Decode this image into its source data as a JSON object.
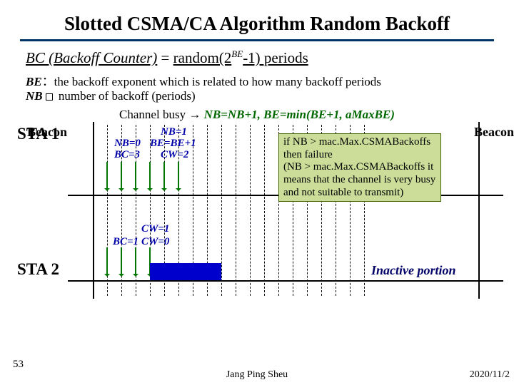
{
  "title": "Slotted CSMA/CA Algorithm Random Backoff",
  "formula": {
    "lhs": "BC (Backoff Counter)",
    "eq": " = ",
    "rhs_a": "random(2",
    "rhs_sup": "BE",
    "rhs_b": "-1) periods"
  },
  "defs": {
    "be_var": "BE",
    "be_text": "：the backoff exponent which is related to how many backoff periods",
    "nb_var": "NB",
    "nb_text": " number of backoff (periods)"
  },
  "rule": {
    "pre": "Channel busy",
    "arrow": " → ",
    "upd": "NB=NB+1,  BE=min(BE+1, aMaxBE)"
  },
  "labels": {
    "beacon_left": "Beacon",
    "beacon_right": "Beacon",
    "sta1": "STA 1",
    "sta2": "STA 2",
    "inactive": "Inactive portion"
  },
  "annos": {
    "nb0": "NB=0",
    "bc3": "BC=3",
    "nb1": "NB=1",
    "bebe1": "BE=BE+1",
    "cw2": "CW=2",
    "cw1": "CW=1",
    "bc1": "BC=1",
    "cw0": "CW=0"
  },
  "note": {
    "l1": "if NB > mac.Max.CSMABackoffs then failure",
    "l2": "(NB > mac.Max.CSMABackoffs it means that the channel is very busy and not suitable to transmit)"
  },
  "footer": {
    "page": "53",
    "author": "Jang Ping Sheu",
    "date": "2020/11/2"
  }
}
